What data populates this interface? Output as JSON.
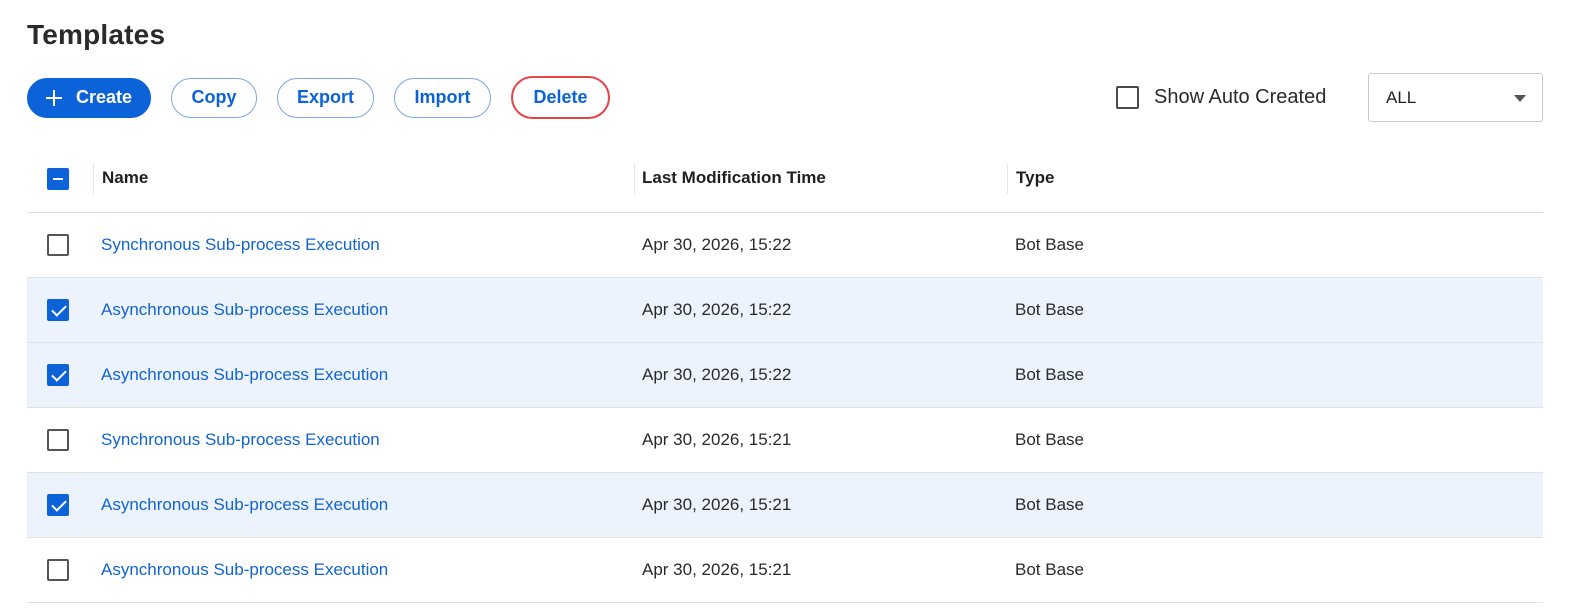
{
  "page": {
    "title": "Templates"
  },
  "toolbar": {
    "create_label": "Create",
    "copy_label": "Copy",
    "export_label": "Export",
    "import_label": "Import",
    "delete_label": "Delete"
  },
  "filters": {
    "show_auto_created_label": "Show Auto Created",
    "show_auto_created_checked": false,
    "type_select_value": "ALL"
  },
  "table": {
    "columns": [
      "Name",
      "Last Modification Time",
      "Type"
    ],
    "header_select_state": "mixed",
    "rows": [
      {
        "name": "Synchronous Sub-process Execution",
        "time": "Apr 30, 2026, 15:22",
        "type": "Bot Base",
        "selected": false
      },
      {
        "name": "Asynchronous Sub-process Execution",
        "time": "Apr 30, 2026, 15:22",
        "type": "Bot Base",
        "selected": true
      },
      {
        "name": "Asynchronous Sub-process Execution",
        "time": "Apr 30, 2026, 15:22",
        "type": "Bot Base",
        "selected": true
      },
      {
        "name": "Synchronous Sub-process Execution",
        "time": "Apr 30, 2026, 15:21",
        "type": "Bot Base",
        "selected": false
      },
      {
        "name": "Asynchronous Sub-process Execution",
        "time": "Apr 30, 2026, 15:21",
        "type": "Bot Base",
        "selected": true
      },
      {
        "name": "Asynchronous Sub-process Execution",
        "time": "Apr 30, 2026, 15:21",
        "type": "Bot Base",
        "selected": false
      }
    ]
  },
  "colors": {
    "accent": "#0b62d9",
    "link": "#1264cf",
    "delete_outline": "#e8424a",
    "selected_row": "#ecf3fc"
  }
}
